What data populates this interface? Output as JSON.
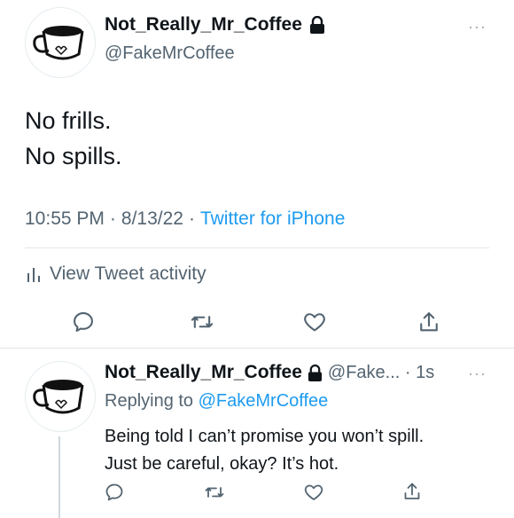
{
  "tweet": {
    "display_name": "Not_Really_Mr_Coffee",
    "handle": "@FakeMrCoffee",
    "text_line1": "No frills.",
    "text_line2": "No spills.",
    "time": "10:55 PM",
    "dot1": "·",
    "date": "8/13/22",
    "dot2": "·",
    "source": "Twitter for iPhone",
    "activity_label": "View Tweet activity",
    "more_icon": "ellipsis-icon"
  },
  "reply": {
    "display_name": "Not_Really_Mr_Coffee",
    "handle_time": "@Fake... · 1s",
    "replying_prefix": "Replying to",
    "replying_handle": "@FakeMrCoffee",
    "text_line1": "Being told I can’t promise you won’t spill.",
    "text_line2": "Just be careful, okay? It’s hot."
  },
  "colors": {
    "link": "#1d9bf0",
    "secondary_text": "#536471",
    "icon": "#536471"
  }
}
